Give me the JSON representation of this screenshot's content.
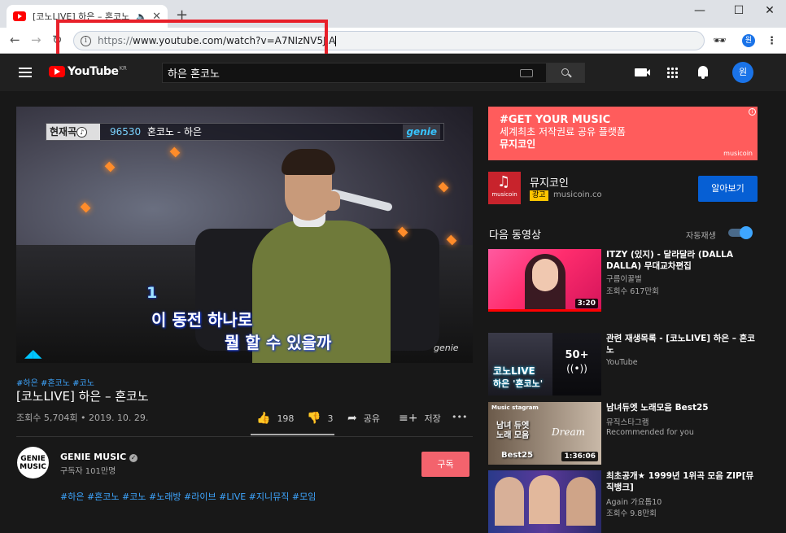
{
  "browser": {
    "tab_title": "[코노LIVE] 하은 – 혼코노",
    "tab_audio_icon": "speaker-icon",
    "url_scheme": "https://",
    "url_rest": "www.youtube.com/watch?v=A7NIzNV5JlA",
    "profile_initial": "원"
  },
  "header": {
    "logo_text": "YouTube",
    "logo_region": "KR",
    "search_value": "하은 혼코노",
    "avatar_initial": "원"
  },
  "player": {
    "now_playing_label": "현재곡",
    "song_number": "96530",
    "song_title": "혼코노 - 하은",
    "brand": "genie",
    "lyric_number": "1",
    "lyric_line1": "이 동전 하나로",
    "lyric_line2": "뭘 할 수 있을까",
    "watermark": "genie"
  },
  "video": {
    "tags": "#하은 #혼코노 #코노",
    "title": "[코노LIVE] 하은 – 혼코노",
    "views": "조회수 5,704회 • 2019. 10. 29.",
    "likes": "198",
    "dislikes": "3",
    "share_label": "공유",
    "save_label": "저장",
    "more_label": "•••"
  },
  "channel": {
    "logo_line1": "GENIE",
    "logo_line2": "MUSIC",
    "name": "GENIE MUSIC",
    "subscribers": "구독자 101만명",
    "subscribe_label": "구독",
    "hashtags": "#하은 #혼코노 #코노 #노래방 #라이브 #LIVE #지니뮤직 #모임"
  },
  "ad": {
    "line1": "#GET YOUR MUSIC",
    "line2": "세계최초 저작권료 공유 플랫폼",
    "line3": "뮤지코인",
    "banner_brand": "musicoin",
    "logo_text": "musicoin",
    "name": "뮤지코인",
    "badge": "광고",
    "domain": "musicoin.co",
    "cta": "알아보기"
  },
  "up_next": {
    "title": "다음 동영상",
    "autoplay_label": "자동재생",
    "autoplay_on": true
  },
  "recommendations": [
    {
      "title": "ITZY (있지) - 달라달라 (DALLA DALLA) 무대교차편집",
      "channel": "구름이꿀벌",
      "meta": "조회수 617만회",
      "duration": "3:20"
    },
    {
      "title": "관련 재생목록 - [코노LIVE] 하은 – 혼코노",
      "channel": "YouTube",
      "playlist_count": "50+",
      "thumb_text1": "코노LIVE",
      "thumb_text2": "하은 '혼코노'"
    },
    {
      "title": "남녀듀엣 노래모음 Best25",
      "channel": "뮤직스타그램",
      "meta": "Recommended for you",
      "duration": "1:36:06",
      "thumb_text1": "Music stagram",
      "thumb_text2": "남녀 듀엣 노래 모음",
      "thumb_text3": "Best25",
      "thumb_text4": "Dream"
    },
    {
      "title": "최초공개★ 1999년 1위곡 모음 ZIP[뮤직뱅크]",
      "channel": "Again 가요톱10",
      "meta": "조회수 9.8만회"
    }
  ],
  "colors": {
    "background": "#181818",
    "header": "#202020",
    "link": "#3ea6ff",
    "subscribe": "#f3636d",
    "ad_banner": "#ff5c5c",
    "cta": "#065fd4",
    "annotation_box": "#e8202a"
  }
}
